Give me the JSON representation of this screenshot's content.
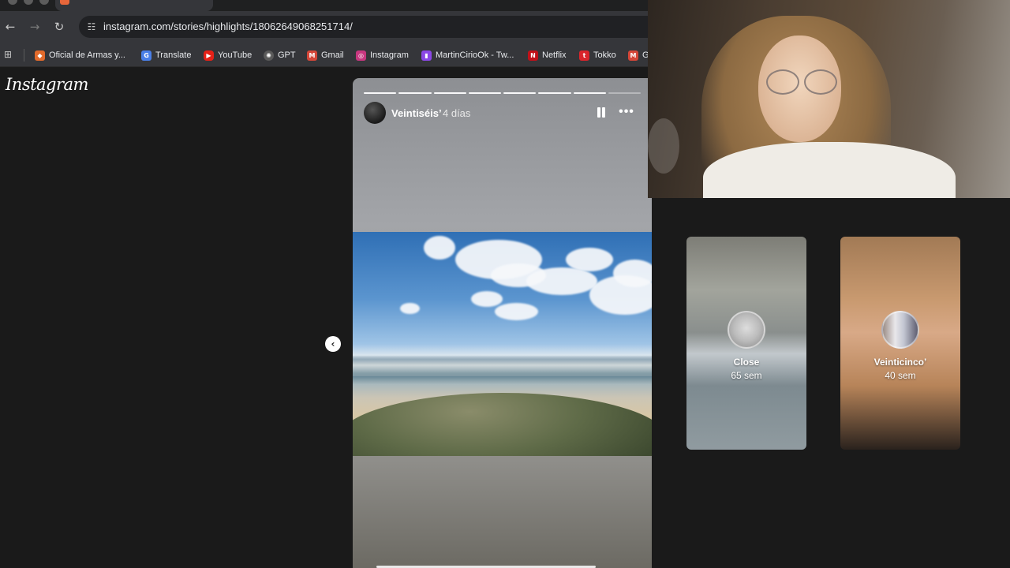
{
  "browser": {
    "url": "instagram.com/stories/highlights/18062649068251714/",
    "bookmarks": [
      {
        "label": "Oficial de Armas y...",
        "icon": "orange-square-icon",
        "color": "#e36b2c"
      },
      {
        "label": "Translate",
        "icon": "translate-icon",
        "color": "#4a7fe8"
      },
      {
        "label": "YouTube",
        "icon": "youtube-icon",
        "color": "#e62117"
      },
      {
        "label": "GPT",
        "icon": "openai-icon",
        "color": "#5a5a5a"
      },
      {
        "label": "Gmail",
        "icon": "gmail-icon",
        "color": "#d44638"
      },
      {
        "label": "Instagram",
        "icon": "instagram-icon",
        "color": "#c7377f"
      },
      {
        "label": "MartinCirioOk - Tw...",
        "icon": "twitch-icon",
        "color": "#8b47e6"
      },
      {
        "label": "Netflix",
        "icon": "netflix-icon",
        "color": "#c11119"
      },
      {
        "label": "Tokko",
        "icon": "tokko-icon",
        "color": "#d9252b"
      },
      {
        "label": "G",
        "icon": "gmail-icon",
        "color": "#d44638"
      }
    ]
  },
  "instagram": {
    "logo": "Instagram",
    "story": {
      "username": "Veintiséis’",
      "time": "4 días",
      "progress_total": 8,
      "progress_done": 7
    },
    "highlights": [
      {
        "title": "Close",
        "subtitle": "65 sem"
      },
      {
        "title": "Veinticinco’",
        "subtitle": "40 sem"
      }
    ]
  }
}
